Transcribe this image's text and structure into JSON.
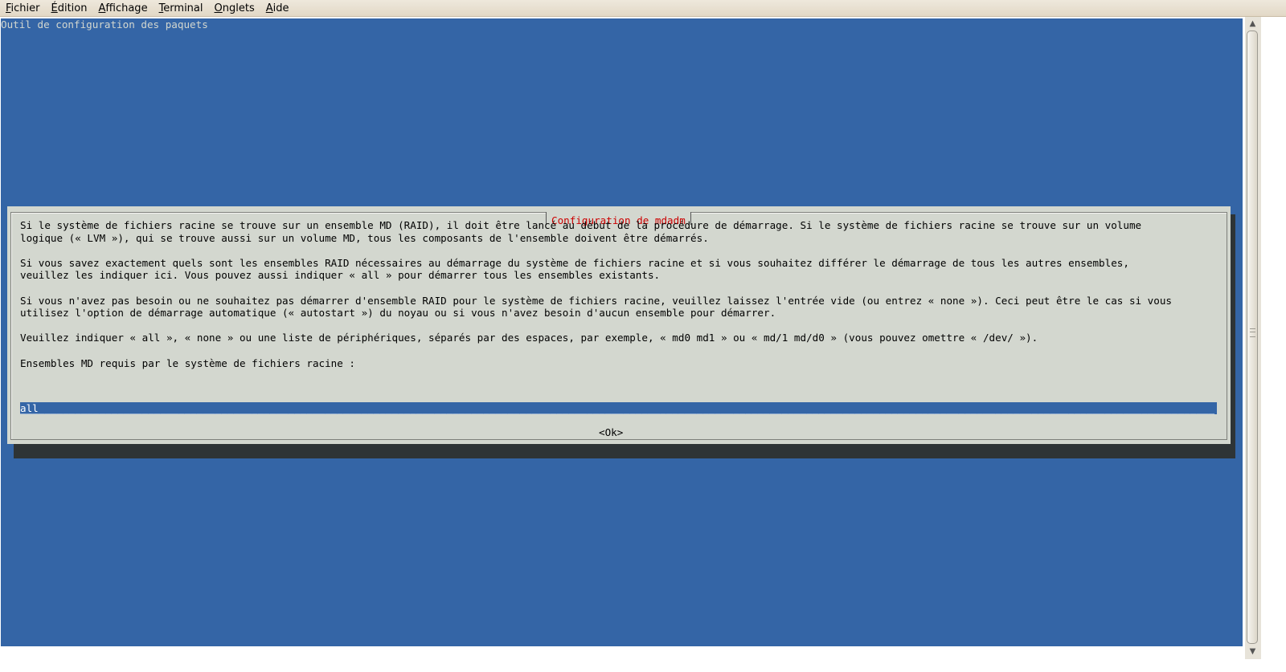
{
  "menubar": {
    "items": [
      {
        "mnemonic": "F",
        "rest": "ichier"
      },
      {
        "mnemonic": "É",
        "rest": "dition"
      },
      {
        "mnemonic": "A",
        "rest": "ffichage"
      },
      {
        "mnemonic": "T",
        "rest": "erminal"
      },
      {
        "mnemonic": "O",
        "rest": "nglets"
      },
      {
        "mnemonic": "A",
        "rest": "ide"
      }
    ]
  },
  "terminal": {
    "backtitle": "Outil de configuration des paquets",
    "colors": {
      "background": "#3465a6",
      "dialog": "#d3d7cf",
      "title": "#cc0000",
      "shadow": "#2e3436"
    }
  },
  "dialog": {
    "title": "Configuration de mdadm",
    "paragraphs": [
      "Si le système de fichiers racine se trouve sur un ensemble MD (RAID), il doit être lancé au début de la procédure de démarrage. Si le système de fichiers racine se trouve sur un volume\nlogique (« LVM »), qui se trouve aussi sur un volume MD, tous les composants de l'ensemble doivent être démarrés.",
      "Si vous savez exactement quels sont les ensembles RAID nécessaires au démarrage du système de fichiers racine et si vous souhaitez différer le démarrage de tous les autres ensembles,\nveuillez les indiquer ici. Vous pouvez aussi indiquer « all » pour démarrer tous les ensembles existants.",
      "Si vous n'avez pas besoin ou ne souhaitez pas démarrer d'ensemble RAID pour le système de fichiers racine, veuillez laissez l'entrée vide (ou entrez « none »). Ceci peut être le cas si vous\nutilisez l'option de démarrage automatique (« autostart ») du noyau ou si vous n'avez besoin d'aucun ensemble pour démarrer.",
      "Veuillez indiquer « all », « none » ou une liste de périphériques, séparés par des espaces, par exemple, « md0 md1 » ou « md/1 md/d0 » (vous pouvez omettre « /dev/ »).",
      "Ensembles MD requis par le système de fichiers racine :"
    ],
    "entry_value": "all",
    "ok_label": "<Ok>"
  },
  "scrollbar": {
    "up_icon": "triangle-up",
    "down_icon": "triangle-down"
  }
}
